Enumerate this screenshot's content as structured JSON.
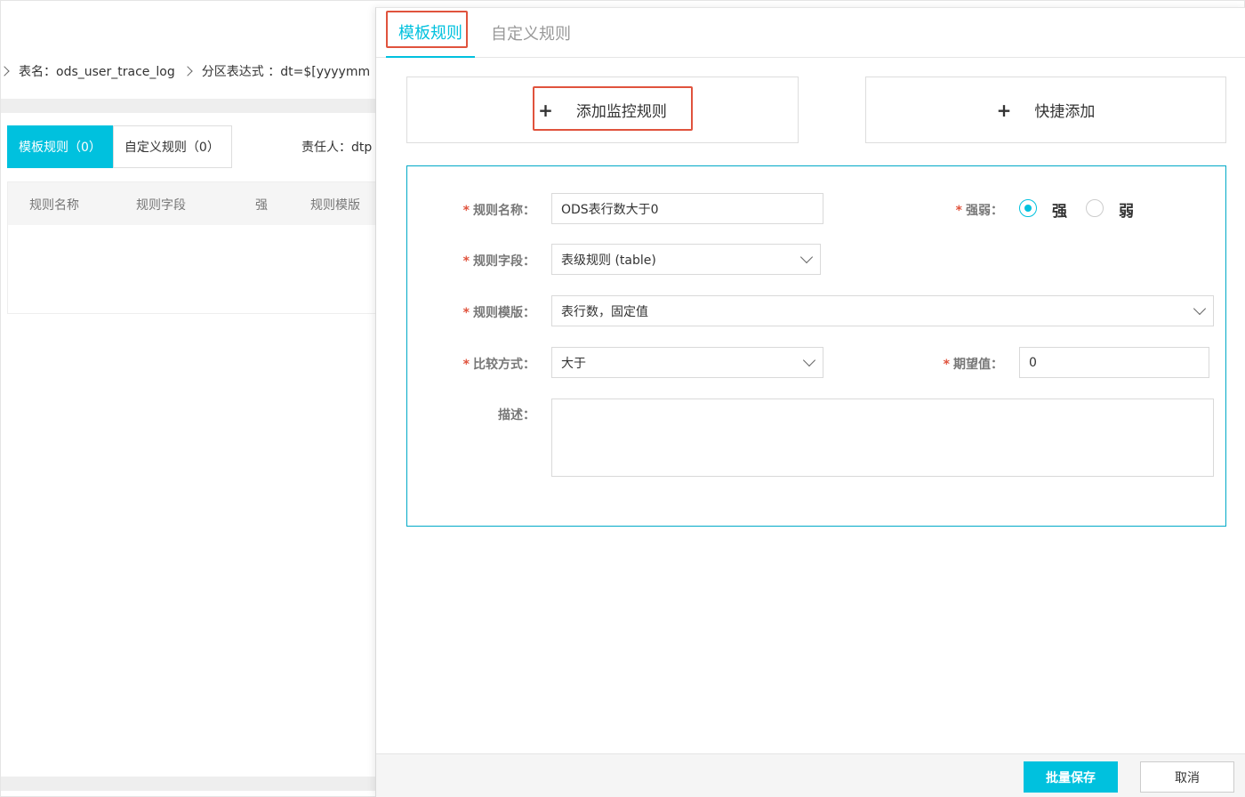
{
  "background": {
    "breadcrumb": {
      "table_name": "表名：ods_user_trace_log",
      "partition": "分区表达式 ：dt=$[yyyymm"
    },
    "tabs": [
      {
        "label": "模板规则（0）",
        "active": true
      },
      {
        "label": "自定义规则（0）",
        "active": false
      }
    ],
    "owner": "责任人：dtp",
    "table_headers": [
      "规则名称",
      "规则字段",
      "强",
      "规则模版"
    ]
  },
  "drawer": {
    "tabs": [
      {
        "label": "模板规则",
        "active": true
      },
      {
        "label": "自定义规则",
        "active": false
      }
    ],
    "add_monitor_rule": "添加监控规则",
    "quick_add": "快捷添加",
    "plus": "+",
    "form": {
      "required_mark": "*",
      "rule_name_label": "规则名称：",
      "rule_name_value": "ODS表行数大于0",
      "strength_label": "强弱：",
      "strength_options": [
        {
          "label": "强",
          "checked": true
        },
        {
          "label": "弱",
          "checked": false
        }
      ],
      "rule_field_label": "规则字段：",
      "rule_field_value": "表级规则 (table)",
      "rule_template_label": "规则模版：",
      "rule_template_value": "表行数，固定值",
      "compare_label": "比较方式：",
      "compare_value": "大于",
      "expected_label": "期望值：",
      "expected_value": "0",
      "description_label": "描述："
    },
    "footer": {
      "batch_save": "批量保存",
      "cancel": "取消"
    }
  },
  "colors": {
    "accent": "#00c1de",
    "highlight": "#e0533d",
    "required": "#e0533d"
  }
}
